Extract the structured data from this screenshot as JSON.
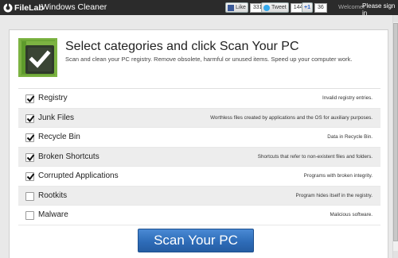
{
  "header": {
    "logo_text": "FileLab",
    "app_title": "Windows Cleaner",
    "social": {
      "facebook": {
        "label": "Like",
        "count": "331"
      },
      "twitter": {
        "label": "Tweet",
        "count": "144"
      },
      "google": {
        "label": "+1",
        "count": "36"
      }
    },
    "welcome": "Welcome!",
    "sign_in": "Please sign in"
  },
  "main": {
    "headline": "Select categories and click Scan Your PC",
    "subtext": "Scan and clean your PC registry. Remove obsolete, harmful or unused items. Speed up your computer work.",
    "categories": [
      {
        "label": "Registry",
        "description": "Invalid registry entries.",
        "checked": true
      },
      {
        "label": "Junk Files",
        "description": "Worthless files created by applications and the OS for auxiliary purposes.",
        "checked": true
      },
      {
        "label": "Recycle Bin",
        "description": "Data in Recycle Bin.",
        "checked": true
      },
      {
        "label": "Broken Shortcuts",
        "description": "Shortcuts that refer to non-existent files and folders.",
        "checked": true
      },
      {
        "label": "Corrupted Applications",
        "description": "Programs with broken integrity.",
        "checked": true
      },
      {
        "label": "Rootkits",
        "description": "Program hides itself in the registry.",
        "checked": false
      },
      {
        "label": "Malware",
        "description": "Malicious software.",
        "checked": false
      }
    ],
    "scan_button": "Scan Your PC"
  },
  "colors": {
    "topbar": "#2b2b2b",
    "accent_green": "#7cb342",
    "button_blue": "#2e6cb8"
  }
}
